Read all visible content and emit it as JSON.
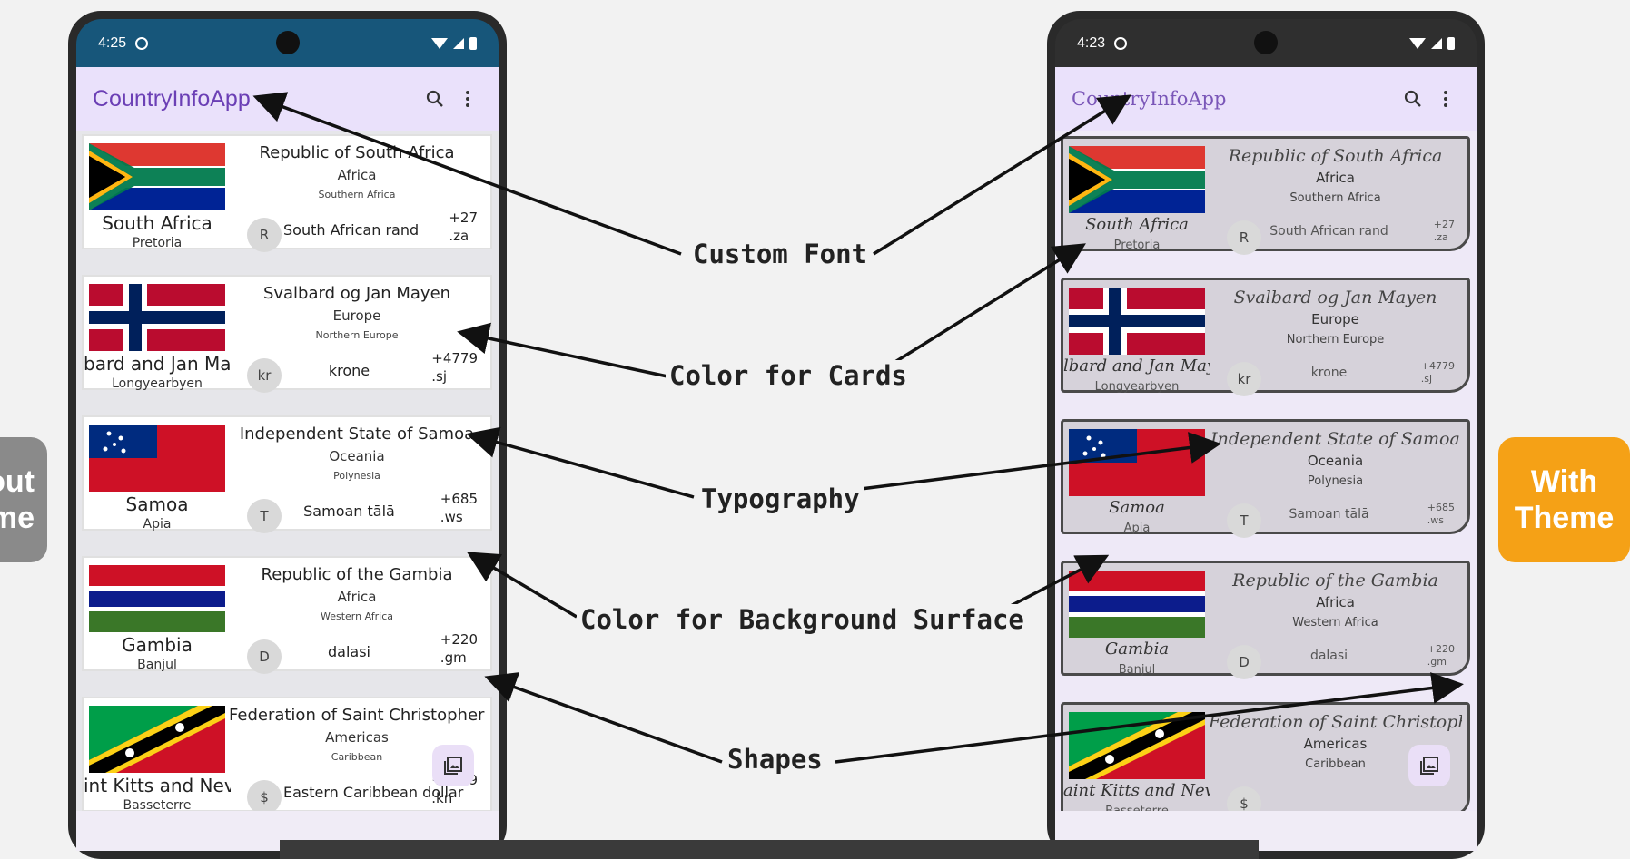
{
  "side_labels": {
    "left": "out\nme",
    "right": "With\nTheme"
  },
  "callouts": {
    "custom_font": "Custom Font",
    "color_cards": "Color for Cards",
    "typography": "Typography",
    "color_background": "Color for Background Surface",
    "shapes": "Shapes"
  },
  "left_phone": {
    "status_time": "4:25",
    "app_title": "CountryInfoApp",
    "icons": [
      "search-icon",
      "more-vert-icon",
      "collections-icon"
    ],
    "cards": [
      {
        "official": "Republic of South Africa",
        "region": "Africa",
        "subregion": "Southern Africa",
        "name": "South Africa",
        "capital": "Pretoria",
        "avatar": "R",
        "currency": "South African rand",
        "dial": "+27\n.za",
        "flag": "south-africa"
      },
      {
        "official": "Svalbard og Jan Mayen",
        "region": "Europe",
        "subregion": "Northern Europe",
        "name": "bard and Jan Mayen",
        "capital": "Longyearbyen",
        "avatar": "kr",
        "currency": "krone",
        "dial": "+4779\n.sj",
        "flag": "norway"
      },
      {
        "official": "Independent State of Samoa",
        "region": "Oceania",
        "subregion": "Polynesia",
        "name": "Samoa",
        "capital": "Apia",
        "avatar": "T",
        "currency": "Samoan tālā",
        "dial": "+685\n.ws",
        "flag": "samoa"
      },
      {
        "official": "Republic of the Gambia",
        "region": "Africa",
        "subregion": "Western Africa",
        "name": "Gambia",
        "capital": "Banjul",
        "avatar": "D",
        "currency": "dalasi",
        "dial": "+220\n.gm",
        "flag": "gambia"
      },
      {
        "official": "Federation of Saint Christopher and Nevis",
        "region": "Americas",
        "subregion": "Caribbean",
        "name": "int Kitts and Nevis",
        "capital": "Basseterre",
        "avatar": "$",
        "currency": "Eastern Caribbean dollar",
        "dial": "+1869\n.kn",
        "flag": "saint-kitts"
      }
    ]
  },
  "right_phone": {
    "status_time": "4:23",
    "app_title": "CountryInfoApp",
    "cards": [
      {
        "official": "Republic of South Africa",
        "region": "Africa",
        "subregion": "Southern Africa",
        "name": "South Africa",
        "capital": "Pretoria",
        "avatar": "R",
        "currency": "South African rand",
        "dial": "+27\n.za",
        "flag": "south-africa"
      },
      {
        "official": "Svalbard og Jan Mayen",
        "region": "Europe",
        "subregion": "Northern Europe",
        "name": "lbard and Jan Mayen",
        "capital": "Longyearbyen",
        "avatar": "kr",
        "currency": "krone",
        "dial": "+4779\n.sj",
        "flag": "norway"
      },
      {
        "official": "Independent State of Samoa",
        "region": "Oceania",
        "subregion": "Polynesia",
        "name": "Samoa",
        "capital": "Apia",
        "avatar": "T",
        "currency": "Samoan tālā",
        "dial": "+685\n.ws",
        "flag": "samoa"
      },
      {
        "official": "Republic of the Gambia",
        "region": "Africa",
        "subregion": "Western Africa",
        "name": "Gambia",
        "capital": "Banjul",
        "avatar": "D",
        "currency": "dalasi",
        "dial": "+220\n.gm",
        "flag": "gambia"
      },
      {
        "official": "Federation of Saint Christopher and Nevis",
        "region": "Americas",
        "subregion": "Caribbean",
        "name": "aint Kitts and Nevis",
        "capital": "Basseterre",
        "avatar": "$",
        "currency": "",
        "dial": "",
        "flag": "saint-kitts"
      }
    ]
  },
  "colors": {
    "accent_orange": "#f5a116",
    "app_purple": "#6b3fb5",
    "appbar_bg": "#eae1fb"
  }
}
